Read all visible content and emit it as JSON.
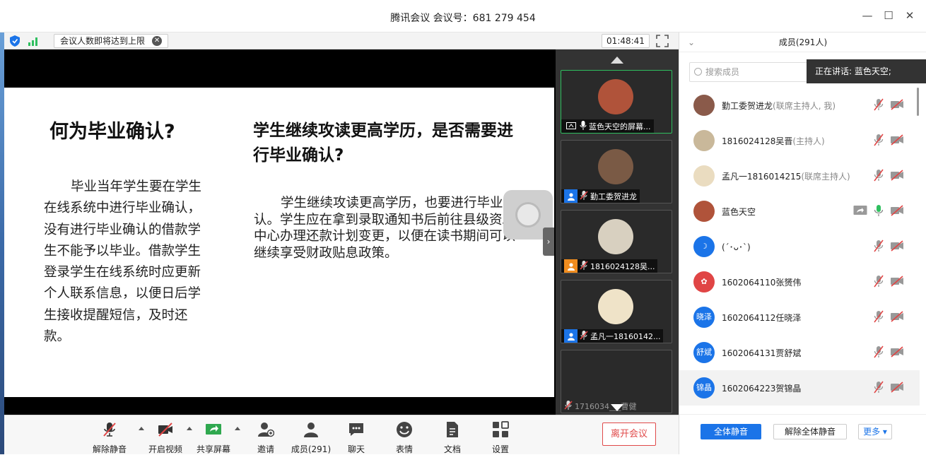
{
  "window": {
    "title": "腾讯会议 会议号：681 279 454",
    "minimize": "—",
    "maximize": "☐",
    "close": "✕"
  },
  "infobar": {
    "notice": "会议人数即将达到上限",
    "close_glyph": "✕",
    "timer": "01:48:41"
  },
  "slide": {
    "left_heading": "何为毕业确认?",
    "left_body": "毕业当年学生要在学生在线系统中进行毕业确认，没有进行毕业确认的借款学生不能予以毕业。借款学生登录学生在线系统时应更新个人联系信息，以便日后学生接收提醒短信，及时还款。",
    "right_heading": "学生继续攻读更高学历，是否需要进行毕业确认?",
    "right_body": "学生继续攻读更高学历，也要进行毕业确认。学生应在拿到录取通知书后前往县级资助中心办理还款计划变更，以便在读书期间可以继续享受财政贴息政策。",
    "collapse_glyph": "›"
  },
  "thumbnails": [
    {
      "label": "蓝色天空的屏幕...",
      "color": "#b0533a",
      "tag": "screen"
    },
    {
      "label": "勤工委贺进龙",
      "color": "#7a5a45",
      "tag": "user-blue"
    },
    {
      "label": "1816024128吴...",
      "color": "#d8d0c0",
      "tag": "user-orange"
    },
    {
      "label": "孟凡一18160142...",
      "color": "#efe3c8",
      "tag": "user-blue"
    },
    {
      "label": "1716034___曹健",
      "color": "#2a2a2a",
      "tag": "none"
    }
  ],
  "toolbar": {
    "mute_label": "解除静音",
    "video_label": "开启视频",
    "share_label": "共享屏幕",
    "invite_label": "邀请",
    "members_label": "成员(291)",
    "chat_label": "聊天",
    "emoji_label": "表情",
    "docs_label": "文档",
    "settings_label": "设置",
    "leave_label": "离开会议"
  },
  "panel": {
    "title": "成员(291人)",
    "search_placeholder": "搜索成员",
    "speaking": "正在讲话: 蓝色天空;",
    "mute_all": "全体静音",
    "unmute_all": "解除全体静音",
    "more": "更多 ▾",
    "members": [
      {
        "name": "勤工委贺进龙",
        "role": "(联席主持人, 我)",
        "avatar_text": "",
        "avatar_color": "#8a5a4a",
        "mic": "muted",
        "screen": false
      },
      {
        "name": "1816024128吴晋",
        "role": "(主持人)",
        "avatar_text": "",
        "avatar_color": "#c9b89a",
        "mic": "muted",
        "screen": false
      },
      {
        "name": "孟凡一1816014215",
        "role": "(联席主持人)",
        "avatar_text": "",
        "avatar_color": "#eadcc0",
        "mic": "muted",
        "screen": false
      },
      {
        "name": "蓝色天空",
        "role": "",
        "avatar_text": "",
        "avatar_color": "#b0533a",
        "mic": "on",
        "screen": true
      },
      {
        "name": "(´･ᴗ･`)",
        "role": "",
        "avatar_text": "☽",
        "avatar_color": "#1b74e8",
        "mic": "muted",
        "screen": false
      },
      {
        "name": "1602064110张赟伟",
        "role": "",
        "avatar_text": "✿",
        "avatar_color": "#e04545",
        "mic": "muted",
        "screen": false
      },
      {
        "name": "1602064112任晓泽",
        "role": "",
        "avatar_text": "晓泽",
        "avatar_color": "#1b74e8",
        "mic": "muted",
        "screen": false
      },
      {
        "name": "1602064131贾舒斌",
        "role": "",
        "avatar_text": "舒斌",
        "avatar_color": "#1b74e8",
        "mic": "muted",
        "screen": false
      },
      {
        "name": "1602064223贺锦晶",
        "role": "",
        "avatar_text": "锦晶",
        "avatar_color": "#1b74e8",
        "mic": "muted",
        "screen": false
      }
    ]
  }
}
